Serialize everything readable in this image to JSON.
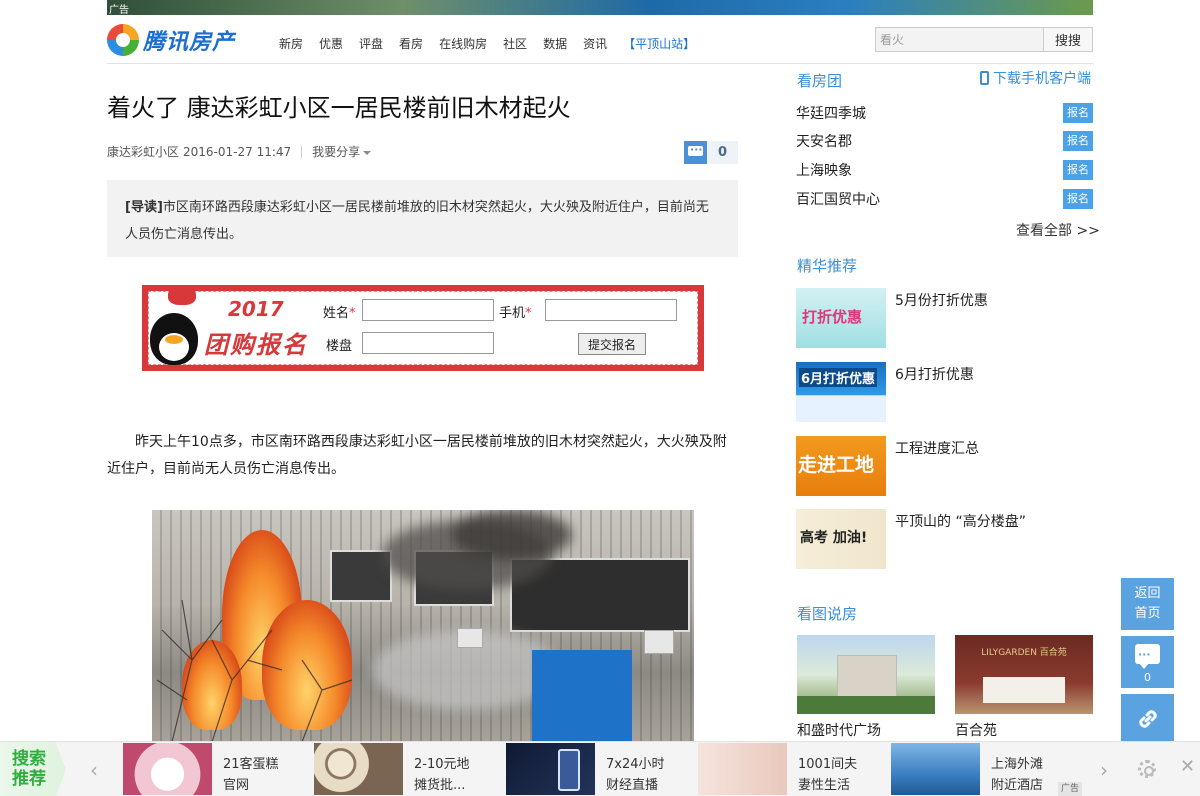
{
  "top_ad": {
    "tag": "广告"
  },
  "header": {
    "logo_text": "腾讯房产",
    "nav": [
      "新房",
      "优惠",
      "评盘",
      "看房",
      "在线购房",
      "社区",
      "数据",
      "资讯"
    ],
    "site_label": "【平顶山站】",
    "search_value": "看火",
    "search_button": "搜搜"
  },
  "article": {
    "title": "着火了 康达彩虹小区一居民楼前旧木材起火",
    "meta_source": "康达彩虹小区",
    "meta_time": "2016-01-27 11:47",
    "meta_share": "我要分享",
    "comment_count": "0",
    "lead_tag": "[导读]",
    "lead_text": "市区南环路西段康达彩虹小区一居民楼前堆放的旧木材突然起火，大火殃及附近住户，目前尚无人员伤亡消息传出。",
    "paragraph": "昨天上午10点多，市区南环路西段康达彩虹小区一居民楼前堆放的旧木材突然起火，大火殃及附近住户，目前尚无人员伤亡消息传出。"
  },
  "groupbuy": {
    "year": "2017",
    "slogan": "团购报名",
    "name_label": "姓名",
    "phone_label": "手机",
    "estate_label": "楼盘",
    "required_mark": "*",
    "submit_label": "提交报名"
  },
  "sidebar": {
    "tour_title": "看房团",
    "app_download": "下载手机客户端",
    "tours": [
      {
        "name": "华廷四季城",
        "btn": "报名"
      },
      {
        "name": "天安名郡",
        "btn": "报名"
      },
      {
        "name": "上海映象",
        "btn": "报名"
      },
      {
        "name": "百汇国贸中心",
        "btn": "报名"
      }
    ],
    "see_all": "查看全部 >>",
    "rec_title": "精华推荐",
    "recs": [
      {
        "label": "5月份打折优惠",
        "thumb_text": "打折优惠"
      },
      {
        "label": "6月打折优惠",
        "thumb_text": "6月打折优惠"
      },
      {
        "label": "工程进度汇总",
        "thumb_text": "走进工地"
      },
      {
        "label": "平顶山的 “高分楼盘”",
        "thumb_text": "高考 加油!"
      }
    ],
    "pic_title": "看图说房",
    "pics": [
      {
        "caption": "和盛时代广场"
      },
      {
        "caption": "百合苑",
        "img_text": "LILYGARDEN 百合苑"
      }
    ]
  },
  "floating": {
    "back": "返回首页",
    "comment_count": "0"
  },
  "bottom_bar": {
    "label": "搜索推荐",
    "items": [
      {
        "line1": "21客蛋糕",
        "line2": "官网"
      },
      {
        "line1": "2-10元地",
        "line2": "摊货批..."
      },
      {
        "line1": "7x24小时",
        "line2": "财经直播"
      },
      {
        "line1": "1001间夫",
        "line2": "妻性生活"
      },
      {
        "line1": "上海外滩",
        "line2": "附近酒店"
      }
    ],
    "ad_tag": "广告"
  },
  "colors": {
    "accent": "#3a8fd6",
    "button_blue": "#4aa3e8",
    "ad_red": "#d8383a",
    "float_blue": "#5aa3e0",
    "green": "#2fae3e"
  }
}
